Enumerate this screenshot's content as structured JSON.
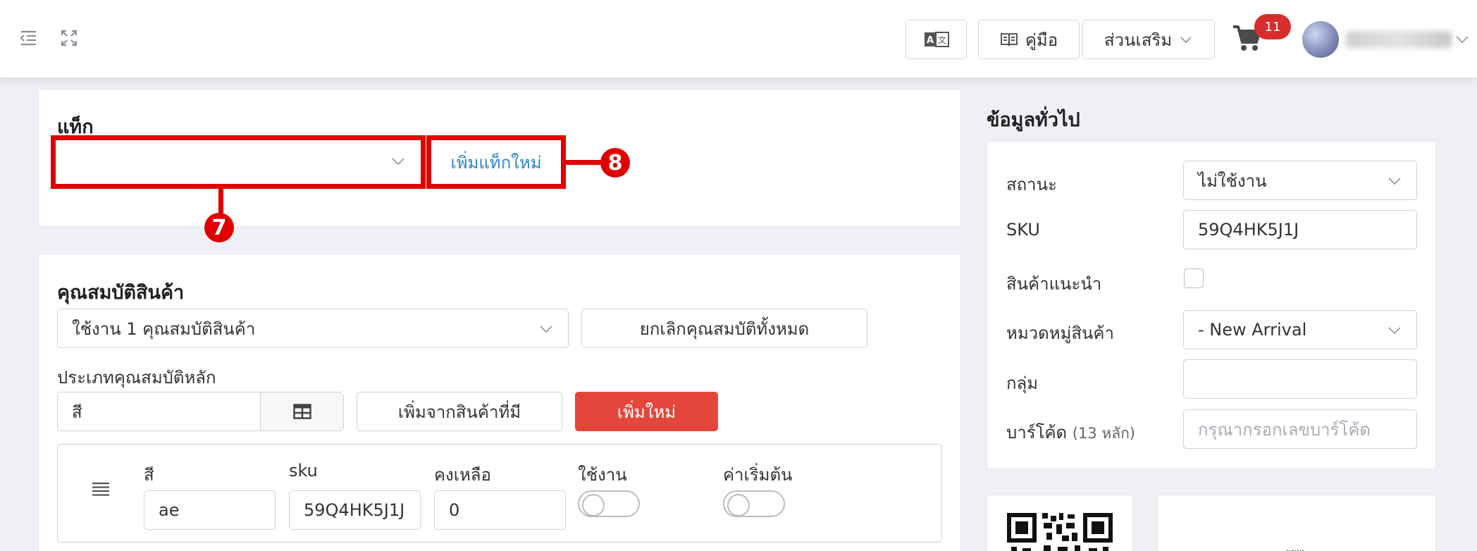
{
  "header": {
    "translate_label": "A文",
    "manual_label": "คู่มือ",
    "addons_label": "ส่วนเสริม",
    "cart_count": "11"
  },
  "tag_section": {
    "title": "แท็ก",
    "select_value": "",
    "add_tag_label": "เพิ่มแท็กใหม่",
    "annotation_select": "7",
    "annotation_add": "8"
  },
  "attributes": {
    "title": "คุณสมบัติสินค้า",
    "attribute_select": "ใช้งาน 1 คุณสมบัติสินค้า",
    "cancel_all_label": "ยกเลิกคุณสมบัติทั้งหมด",
    "main_type_label": "ประเภทคุณสมบัติหลัก",
    "main_type_value": "สี",
    "add_from_existing_label": "เพิ่มจากสินค้าที่มี",
    "add_new_label": "เพิ่มใหม่",
    "table": {
      "col_color": "สี",
      "col_sku": "sku",
      "col_stock": "คงเหลือ",
      "col_active": "ใช้งาน",
      "col_default": "ค่าเริ่มต้น",
      "row": {
        "color": "ae",
        "sku": "59Q4HK5J1J",
        "stock": "0",
        "active": false,
        "default": false
      }
    }
  },
  "general": {
    "title": "ข้อมูลทั่วไป",
    "status_label": "สถานะ",
    "status_value": "ไม่ใช้งาน",
    "sku_label": "SKU",
    "sku_value": "59Q4HK5J1J",
    "featured_label": "สินค้าแนะนำ",
    "featured_checked": false,
    "category_label": "หมวดหมู่สินค้า",
    "category_value": "- New Arrival",
    "group_label": "กลุ่ม",
    "group_value": "",
    "barcode_label": "บาร์โค้ด",
    "barcode_hint": "(13 หลัก)",
    "barcode_placeholder": "กรุณากรอกเลขบาร์โค้ด"
  }
}
